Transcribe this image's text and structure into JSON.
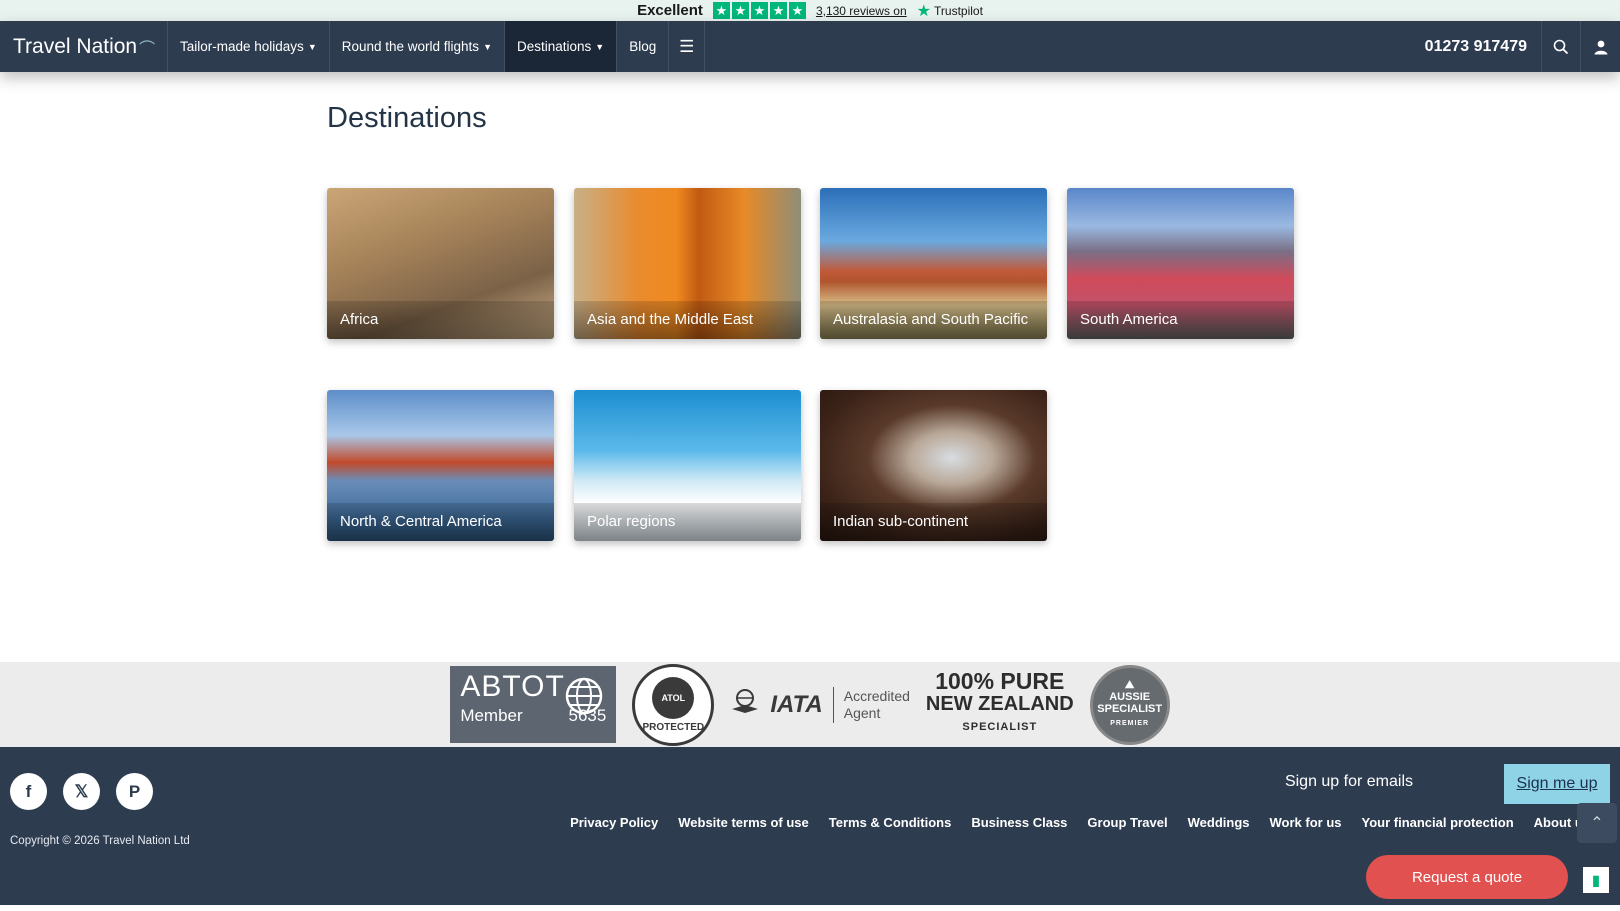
{
  "trustpilot": {
    "rating_word": "Excellent",
    "stars": 5,
    "reviews_text": "3,130 reviews on",
    "brand": "Trustpilot",
    "brand_color": "#00b67a"
  },
  "header": {
    "brand": "Travel Nation",
    "nav": [
      {
        "label": "Tailor-made holidays",
        "has_dropdown": true
      },
      {
        "label": "Round the world flights",
        "has_dropdown": true
      },
      {
        "label": "Destinations",
        "has_dropdown": true,
        "active": true
      },
      {
        "label": "Blog",
        "has_dropdown": false
      }
    ],
    "menu_icon": "hamburger-icon",
    "phone": "01273 917479",
    "search_icon": "search-icon",
    "account_icon": "user-icon",
    "bg_color": "#2e3c50"
  },
  "main": {
    "title": "Destinations",
    "destinations": [
      {
        "label": "Africa"
      },
      {
        "label": "Asia and the Middle East"
      },
      {
        "label": "Australasia and South Pacific"
      },
      {
        "label": "South America"
      },
      {
        "label": "North & Central America"
      },
      {
        "label": "Polar regions"
      },
      {
        "label": "Indian sub-continent"
      }
    ]
  },
  "accreditations": {
    "abtot": {
      "name": "ABTOT",
      "member_label": "Member",
      "member_number": "5635"
    },
    "atol": {
      "name": "ATOL",
      "text": "PROTECTED"
    },
    "iata": {
      "name": "IATA",
      "line1": "Accredited",
      "line2": "Agent"
    },
    "nz": {
      "line1": "100% PURE",
      "line2": "NEW ZEALAND",
      "line3": "SPECIALIST"
    },
    "aussie": {
      "line1": "AUSSIE",
      "line2": "SPECIALIST",
      "line3": "PREMIER"
    }
  },
  "footer": {
    "socials": [
      {
        "icon": "facebook-icon",
        "glyph": "f"
      },
      {
        "icon": "x-icon",
        "glyph": "𝕏"
      },
      {
        "icon": "pinterest-icon",
        "glyph": "P"
      }
    ],
    "copyright": "Copyright © 2026 Travel Nation Ltd",
    "signup_label": "Sign up for emails",
    "signup_button": "Sign me up",
    "links": [
      "Privacy Policy",
      "Website terms of use",
      "Terms & Conditions",
      "Business Class",
      "Group Travel",
      "Weddings",
      "Work for us",
      "Your financial protection",
      "About us"
    ],
    "quote_button": "Request a quote",
    "accent_color": "#e0514f",
    "signup_color": "#8fd4e6"
  }
}
